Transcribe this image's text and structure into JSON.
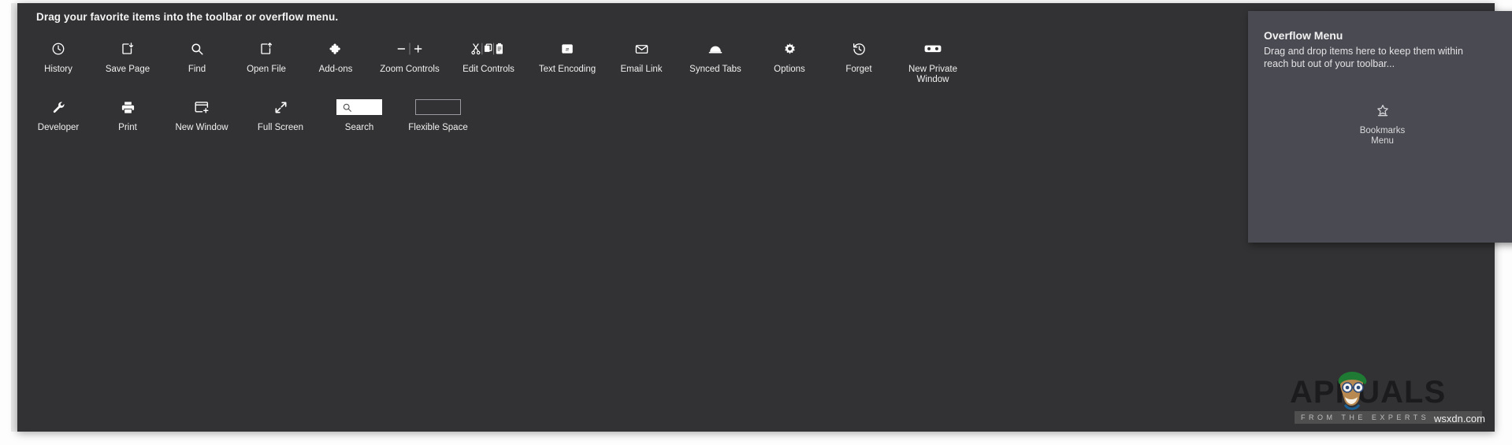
{
  "headline": "Drag your favorite items into the toolbar or overflow menu.",
  "colors": {
    "panel_background": "#323234",
    "overflow_background": "#4a4a52",
    "page_background": "#fdfdfd",
    "text_primary": "#f0f0f0",
    "text_muted": "#d9d9dd",
    "search_field": "#ffffff",
    "flexible_space_border": "#9a9a9e"
  },
  "toolbar_items": {
    "row1": [
      {
        "label": "History",
        "icon": "clock-icon"
      },
      {
        "label": "Save Page",
        "icon": "save-page-icon"
      },
      {
        "label": "Find",
        "icon": "search-icon"
      },
      {
        "label": "Open File",
        "icon": "open-file-icon"
      },
      {
        "label": "Add-ons",
        "icon": "puzzle-piece-icon"
      },
      {
        "label": "Zoom Controls",
        "icon": "zoom-minus-plus-icon"
      },
      {
        "label": "Edit Controls",
        "icon": "cut-copy-paste-icon"
      },
      {
        "label": "Text Encoding",
        "icon": "text-encoding-icon"
      },
      {
        "label": "Email Link",
        "icon": "envelope-icon"
      },
      {
        "label": "Synced Tabs",
        "icon": "synced-tabs-icon"
      },
      {
        "label": "Options",
        "icon": "gear-icon"
      },
      {
        "label": "Forget",
        "icon": "forget-history-icon"
      },
      {
        "label": "New Private\nWindow",
        "icon": "mask-icon"
      }
    ],
    "row2": [
      {
        "label": "Developer",
        "icon": "wrench-icon"
      },
      {
        "label": "Print",
        "icon": "printer-icon"
      },
      {
        "label": "New Window",
        "icon": "new-window-icon"
      },
      {
        "label": "Full Screen",
        "icon": "fullscreen-arrows-icon"
      },
      {
        "label": "Search",
        "icon": "search-field-widget"
      },
      {
        "label": "Flexible Space",
        "icon": "flexible-space-widget"
      }
    ]
  },
  "overflow": {
    "title": "Overflow Menu",
    "description": "Drag and drop items here to keep them within reach but out of your toolbar...",
    "items": [
      {
        "label": "Bookmarks\nMenu",
        "icon": "bookmarks-menu-icon"
      }
    ]
  },
  "watermark": {
    "brand": "APPUALS",
    "tagline": "FROM THE EXPERTS",
    "site": "wsxdn.com"
  }
}
